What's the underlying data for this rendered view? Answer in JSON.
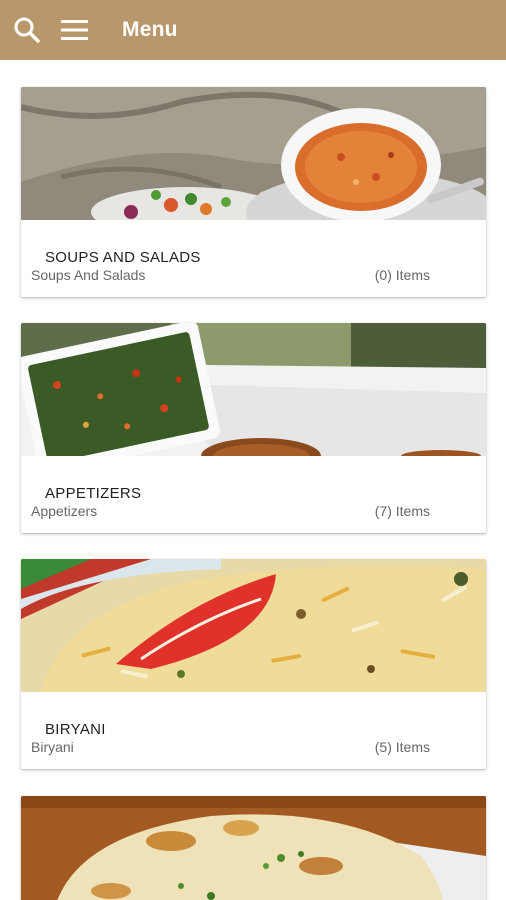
{
  "header": {
    "title": "Menu",
    "bar_color": "#b8976a",
    "icons": [
      "search-icon",
      "hamburger-menu-icon"
    ]
  },
  "categories": [
    {
      "name": "SOUPS AND SALADS",
      "subtitle": "Soups And Salads",
      "count": "(0) Items"
    },
    {
      "name": "APPETIZERS",
      "subtitle": "Appetizers",
      "count": "(7) Items"
    },
    {
      "name": "BIRYANI",
      "subtitle": "Biryani",
      "count": "(5) Items"
    }
  ]
}
